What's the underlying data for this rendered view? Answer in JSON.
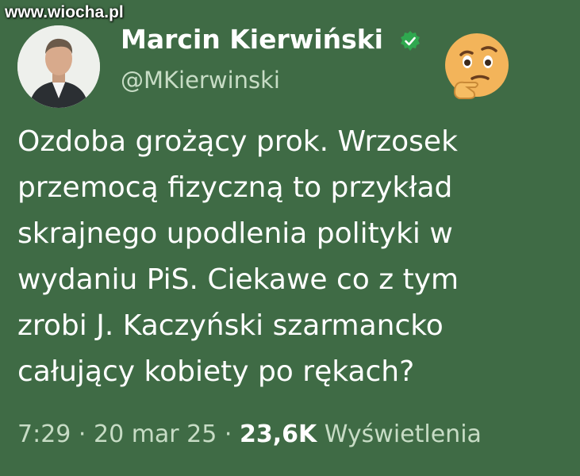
{
  "watermark": "www.wiocha.pl",
  "author": {
    "name": "Marcin Kierwiński",
    "handle": "@MKierwinski",
    "avatar_icon": "profile-photo",
    "verified_icon": "verified-badge-icon"
  },
  "reaction_icon": "thinking-face-emoji",
  "tweet": {
    "lines": [
      "Ozdoba grożący prok. Wrzosek",
      "przemocą fizyczną to przykład",
      "skrajnego  upodlenia polityki w",
      "wydaniu PiS. Ciekawe co z tym",
      "zrobi J. Kaczyński szarmancko",
      "całujący kobiety po rękach?"
    ]
  },
  "meta": {
    "time": "7:29",
    "separator": " · ",
    "date": "20 mar 25",
    "views_count": "23,6K",
    "views_label": "Wyświetlenia"
  },
  "colors": {
    "background": "#3f6b45",
    "text": "#ffffff",
    "secondary": "#c7dcc5",
    "verified": "#2fa84f"
  }
}
